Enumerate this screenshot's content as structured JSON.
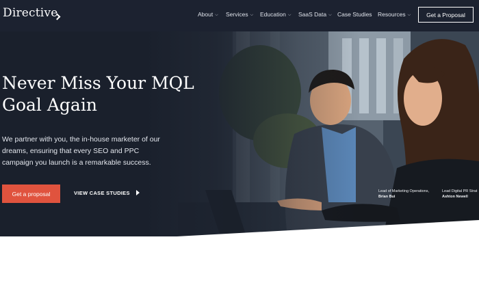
{
  "brand": {
    "logo_text": "Directive"
  },
  "nav": {
    "items": [
      {
        "label": "About",
        "has_dropdown": true
      },
      {
        "label": "Services",
        "has_dropdown": true
      },
      {
        "label": "Education",
        "has_dropdown": true
      },
      {
        "label": "SaaS Data",
        "has_dropdown": true
      },
      {
        "label": "Case Studies",
        "has_dropdown": false
      },
      {
        "label": "Resources",
        "has_dropdown": true
      }
    ],
    "cta_label": "Get a Proposal"
  },
  "hero": {
    "headline_line1": "Never Miss Your MQL",
    "headline_line2": "Goal Again",
    "subtext": "We partner with you, the in-house marketer of our dreams, ensuring that every SEO and PPC campaign you launch is a remarkable success.",
    "primary_cta": "Get a proposal",
    "secondary_cta": "VIEW CASE STUDIES",
    "captions": [
      {
        "role": "Lead of Marketing Operations,",
        "name": "Brian Bui"
      },
      {
        "role": "Lead Digital PR Strat",
        "name": "Ashton Newell"
      }
    ]
  },
  "colors": {
    "header_bg": "#1c2230",
    "accent": "#e0533e",
    "text_light": "#ffffff"
  }
}
